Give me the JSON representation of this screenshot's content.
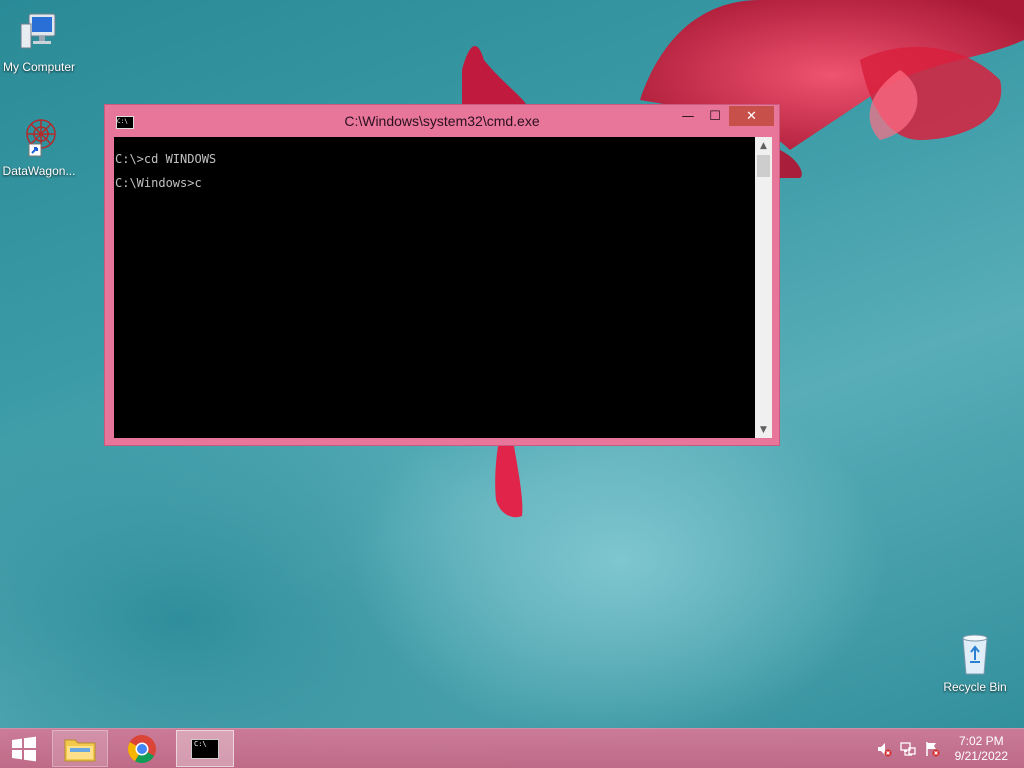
{
  "desktop": {
    "icons": [
      {
        "label": "My Computer",
        "icon": "computer-icon"
      },
      {
        "label": "DataWagon...",
        "icon": "datawagon-icon"
      },
      {
        "label": "Recycle Bin",
        "icon": "recycle-bin-icon"
      }
    ]
  },
  "cmd_window": {
    "title": "C:\\Windows\\system32\\cmd.exe",
    "icon": "cmd-icon",
    "icon_text": "C:\\",
    "buttons": {
      "minimize": "—",
      "maximize": "☐",
      "close": "✕"
    },
    "console_lines": [
      "C:\\>cd WINDOWS",
      "C:\\Windows>c"
    ],
    "scroll_up": "▲",
    "scroll_down": "▼"
  },
  "taskbar": {
    "items": [
      {
        "name": "start",
        "icon": "windows-logo-icon"
      },
      {
        "name": "file-explorer",
        "icon": "folder-icon"
      },
      {
        "name": "chrome",
        "icon": "chrome-icon"
      },
      {
        "name": "command-prompt",
        "icon": "cmd-icon",
        "icon_text": "C:\\"
      }
    ],
    "tray_icons": [
      "volume-muted-icon",
      "network-icon",
      "action-center-flag-icon"
    ],
    "clock": {
      "time": "7:02 PM",
      "date": "9/21/2022"
    }
  },
  "colors": {
    "accent": "#e8759a",
    "close_button": "#c7504a",
    "desktop": "#3b9ba6"
  }
}
